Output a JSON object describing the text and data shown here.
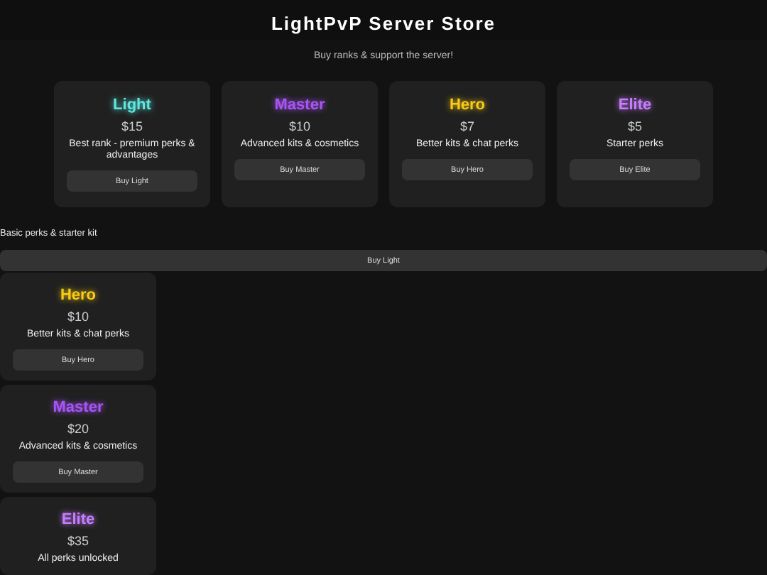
{
  "header": {
    "title": "LightPvP Server Store",
    "subtitle": "Buy ranks & support the server!"
  },
  "featured_ranks": [
    {
      "name": "Light",
      "color": "#5ee8e0",
      "price": "$15",
      "description": "Best rank - premium perks & advantages",
      "button": "Buy Light"
    },
    {
      "name": "Master",
      "color": "#a855f7",
      "price": "$10",
      "description": "Advanced kits & cosmetics",
      "button": "Buy Master"
    },
    {
      "name": "Hero",
      "color": "#facc15",
      "price": "$7",
      "description": "Better kits & chat perks",
      "button": "Buy Hero"
    },
    {
      "name": "Elite",
      "color": "#c77dff",
      "price": "$5",
      "description": "Starter perks",
      "button": "Buy Elite"
    }
  ],
  "loose_description": "Basic perks & starter kit",
  "wide_button": "Buy Light",
  "rank_list": [
    {
      "name": "Hero",
      "color": "#facc15",
      "price": "$10",
      "description": "Better kits & chat perks",
      "button": "Buy Hero"
    },
    {
      "name": "Master",
      "color": "#a855f7",
      "price": "$20",
      "description": "Advanced kits & cosmetics",
      "button": "Buy Master"
    },
    {
      "name": "Elite",
      "color": "#c77dff",
      "price": "$35",
      "description": "All perks unlocked"
    }
  ]
}
